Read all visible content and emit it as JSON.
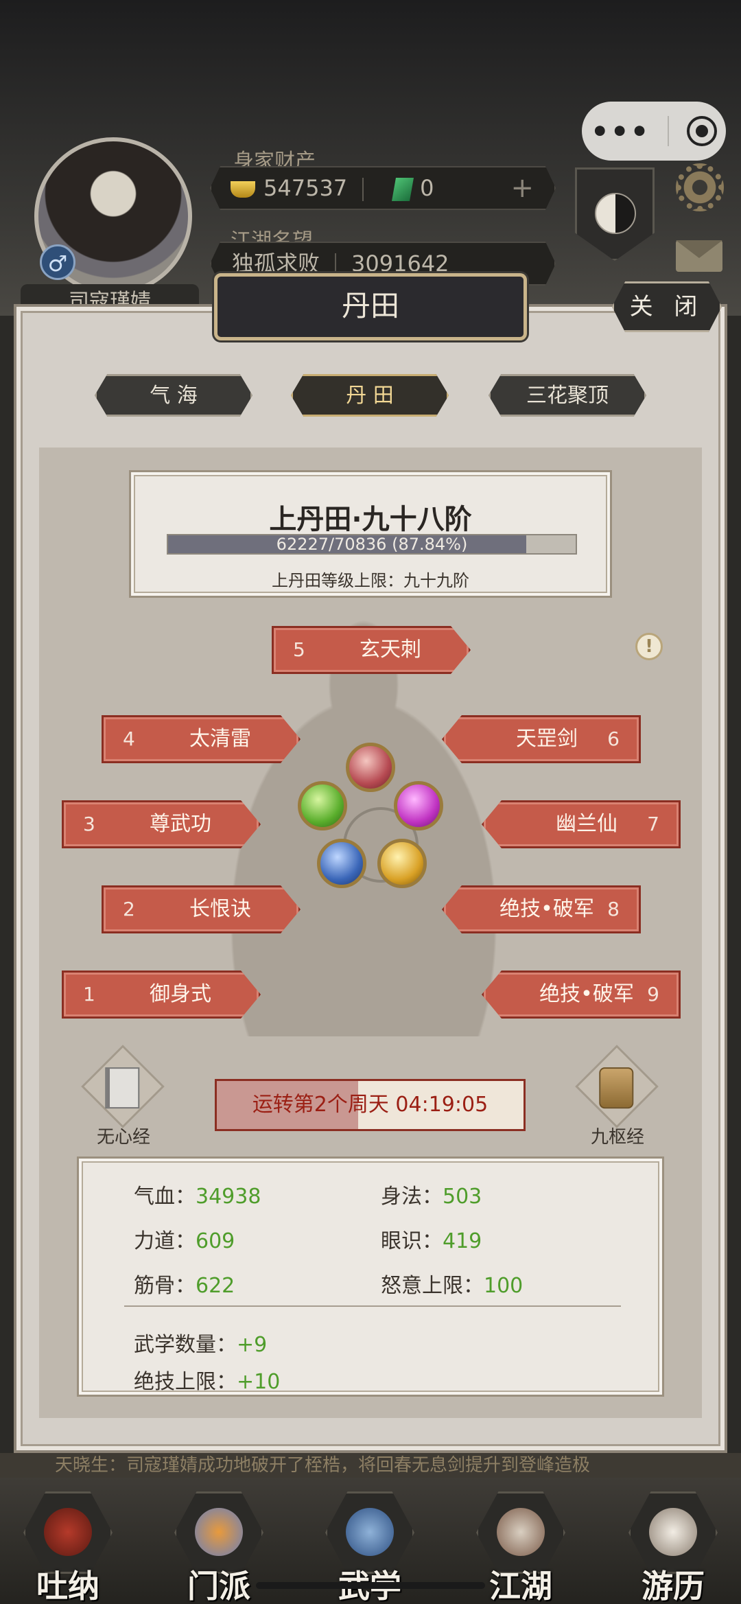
{
  "hud": {
    "wealth_label": "身家财产",
    "ingots": "547537",
    "jade": "0",
    "plus": "+",
    "reputation_label": "江湖名望",
    "reputation_title": "独孤求败",
    "reputation_value": "3091642",
    "player_name": "司寇瑾婧",
    "gender_symbol": "♂",
    "menu_dots": "•••"
  },
  "dialog": {
    "title": "丹田",
    "close_label": "关 闭",
    "tabs": [
      {
        "label": "气 海",
        "active": false
      },
      {
        "label": "丹 田",
        "active": true
      },
      {
        "label": "三花聚顶",
        "active": false
      }
    ]
  },
  "level": {
    "title": "上丹田·九十八阶",
    "progress_text": "62227/70836 (87.84%)",
    "progress_fraction": 0.8784,
    "cap_text": "上丹田等级上限：九十九阶"
  },
  "skills": [
    {
      "num": "1",
      "name": "御身式"
    },
    {
      "num": "2",
      "name": "长恨诀"
    },
    {
      "num": "3",
      "name": "尊武功"
    },
    {
      "num": "4",
      "name": "太清雷"
    },
    {
      "num": "5",
      "name": "玄天刺"
    },
    {
      "num": "6",
      "name": "天罡剑"
    },
    {
      "num": "7",
      "name": "幽兰仙"
    },
    {
      "num": "8",
      "name": "绝技•破军"
    },
    {
      "num": "9",
      "name": "绝技•破军"
    }
  ],
  "info_icon": "!",
  "books": {
    "left_label": "无心经",
    "right_label": "九枢经"
  },
  "cycle": {
    "text": "运转第2个周天 04:19:05",
    "fraction": 0.46
  },
  "stats": {
    "hp_label": "气血：",
    "hp": "34938",
    "agility_label": "身法：",
    "agility": "503",
    "strength_label": "力道：",
    "strength": "609",
    "insight_label": "眼识：",
    "insight": "419",
    "bone_label": "筋骨：",
    "bone": "622",
    "rage_label": "怒意上限：",
    "rage": "100",
    "martial_count_label": "武学数量：",
    "martial_count": "+9",
    "ultimate_cap_label": "绝技上限：",
    "ultimate_cap": "+10"
  },
  "ticker": "天晓生：司寇瑾婧成功地破开了桎梏，将回春无息剑提升到登峰造极",
  "nav": [
    {
      "label": "吐纳"
    },
    {
      "label": "门派"
    },
    {
      "label": "武学"
    },
    {
      "label": "江湖"
    },
    {
      "label": "游历"
    }
  ],
  "colors": {
    "skill_red": "#c55b4a",
    "stat_green": "#4f9d2b",
    "progress_fill": "#6f6f7c"
  }
}
